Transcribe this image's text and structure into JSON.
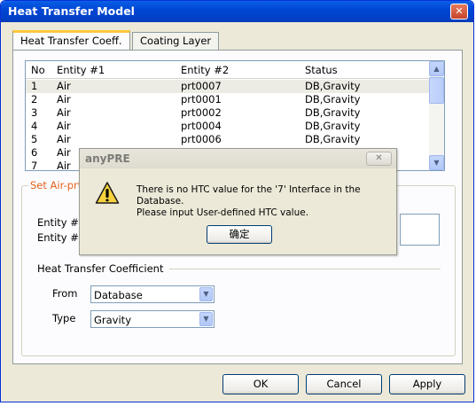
{
  "window": {
    "title": "Heat Transfer Model",
    "close_glyph": "✕"
  },
  "tabs": [
    {
      "label": "Heat Transfer Coeff."
    },
    {
      "label": "Coating Layer"
    }
  ],
  "table": {
    "columns": [
      "No",
      "Entity #1",
      "Entity #2",
      "Status"
    ],
    "rows": [
      {
        "no": "1",
        "e1": "Air",
        "e2": "prt0007",
        "status": "DB,Gravity"
      },
      {
        "no": "2",
        "e1": "Air",
        "e2": "prt0001",
        "status": "DB,Gravity"
      },
      {
        "no": "3",
        "e1": "Air",
        "e2": "prt0002",
        "status": "DB,Gravity"
      },
      {
        "no": "4",
        "e1": "Air",
        "e2": "prt0004",
        "status": "DB,Gravity"
      },
      {
        "no": "5",
        "e1": "Air",
        "e2": "prt0006",
        "status": "DB,Gravity"
      },
      {
        "no": "6",
        "e1": "Air",
        "e2": "",
        "status": ""
      },
      {
        "no": "7",
        "e1": "Air",
        "e2": "",
        "status": ""
      }
    ],
    "selected_row": "1"
  },
  "group": {
    "title": "Set Air-prt",
    "entity1_label": "Entity #1",
    "entity2_label": "Entity #2",
    "htc_label": "Heat Transfer Coefficient",
    "from_label": "From",
    "from_value": "Database",
    "type_label": "Type",
    "type_value": "Gravity"
  },
  "buttons": {
    "ok": "OK",
    "cancel": "Cancel",
    "apply": "Apply"
  },
  "dialog": {
    "title": "anyPRE",
    "close_glyph": "✕",
    "message_line1": "There is no HTC value for the '7' Interface in the Database.",
    "message_line2": "Please input User-defined HTC value.",
    "confirm": "确定",
    "icon": "warning-icon"
  },
  "colors": {
    "titlebar": "#0046d5",
    "tab_highlight": "#ffc83c",
    "group_title": "#e35f1b"
  }
}
